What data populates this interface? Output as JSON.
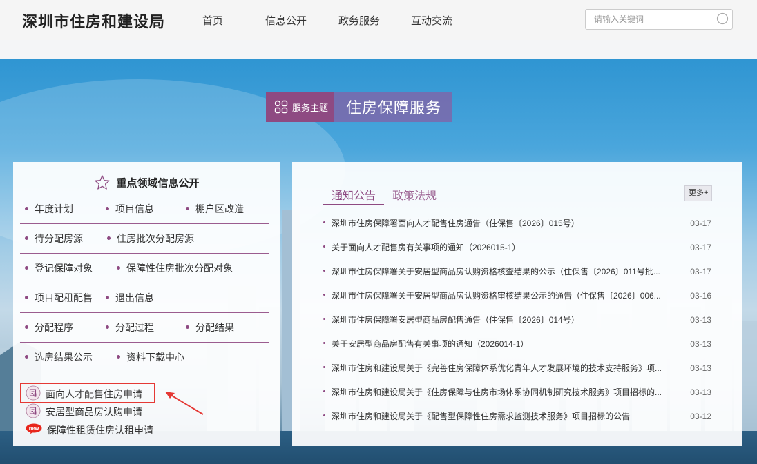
{
  "header": {
    "logo": "深圳市住房和建设局",
    "nav": [
      "首页",
      "信息公开",
      "政务服务",
      "互动交流"
    ],
    "search_placeholder": "请输入关键词"
  },
  "service": {
    "label": "服务主题",
    "title": "住房保障服务"
  },
  "left_panel": {
    "title": "重点领域信息公开",
    "rows": [
      [
        "年度计划",
        "项目信息",
        "棚户区改造"
      ],
      [
        "待分配房源",
        "住房批次分配房源"
      ],
      [
        "登记保障对象",
        "保障性住房批次分配对象"
      ],
      [
        "项目配租配售",
        "退出信息"
      ],
      [
        "分配程序",
        "分配过程",
        "分配结果"
      ],
      [
        "选房结果公示",
        "资料下载中心"
      ]
    ],
    "applications": [
      {
        "label": "面向人才配售住房申请",
        "icon": "apply-icon"
      },
      {
        "label": "安居型商品房认购申请",
        "icon": "apply-icon"
      },
      {
        "label": "保障性租赁住房认租申请",
        "icon": "new-badge-icon",
        "badge": "new"
      }
    ]
  },
  "right_panel": {
    "tabs": [
      "通知公告",
      "政策法规"
    ],
    "more": "更多+",
    "news": [
      {
        "title": "深圳市住房保障署面向人才配售住房通告（住保售〔2026〕015号）",
        "date": "03-17"
      },
      {
        "title": "关于面向人才配售房有关事项的通知（2026015-1）",
        "date": "03-17"
      },
      {
        "title": "深圳市住房保障署关于安居型商品房认购资格核查结果的公示（住保售〔2026〕011号批...",
        "date": "03-17"
      },
      {
        "title": "深圳市住房保障署关于安居型商品房认购资格审核结果公示的通告（住保售〔2026〕006...",
        "date": "03-16"
      },
      {
        "title": "深圳市住房保障署安居型商品房配售通告（住保售〔2026〕014号）",
        "date": "03-13"
      },
      {
        "title": "关于安居型商品房配售有关事项的通知（2026014-1）",
        "date": "03-13"
      },
      {
        "title": "深圳市住房和建设局关于《完善住房保障体系优化青年人才发展环境的技术支持服务》项...",
        "date": "03-13"
      },
      {
        "title": "深圳市住房和建设局关于《住房保障与住房市场体系协同机制研究技术服务》项目招标的...",
        "date": "03-13"
      },
      {
        "title": "深圳市住房和建设局关于《配售型保障性住房需求监测技术服务》项目招标的公告",
        "date": "03-12"
      }
    ]
  },
  "colors": {
    "accent": "#8e4a82",
    "highlight": "#e53935"
  }
}
